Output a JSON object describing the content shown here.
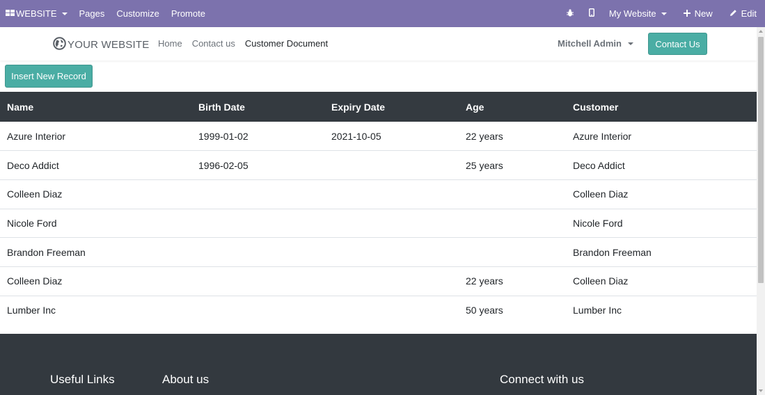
{
  "edit_bar": {
    "app_label": "WEBSITE",
    "pages": "Pages",
    "customize": "Customize",
    "promote": "Promote",
    "website_selector": "My Website",
    "new": "New",
    "edit": "Edit",
    "icons": [
      "apps-grid-icon",
      "bug-icon",
      "mobile-icon",
      "plus-icon",
      "pencil-icon"
    ]
  },
  "header": {
    "logo_text": "YOUR WEBSITE",
    "nav": [
      "Home",
      "Contact us",
      "Customer Document"
    ],
    "active_nav": "Customer Document",
    "user": "Mitchell Admin",
    "contact_button": "Contact Us"
  },
  "main": {
    "insert_button": "Insert New Record",
    "table": {
      "columns": [
        "Name",
        "Birth Date",
        "Expiry Date",
        "Age",
        "Customer"
      ],
      "rows": [
        [
          "Azure Interior",
          "1999-01-02",
          "2021-10-05",
          "22 years",
          "Azure Interior"
        ],
        [
          "Deco Addict",
          "1996-02-05",
          "",
          "25 years",
          "Deco Addict"
        ],
        [
          "Colleen Diaz",
          "",
          "",
          "",
          "Colleen Diaz"
        ],
        [
          "Nicole Ford",
          "",
          "",
          "",
          "Nicole Ford"
        ],
        [
          "Brandon Freeman",
          "",
          "",
          "",
          "Brandon Freeman"
        ],
        [
          "Colleen Diaz",
          "",
          "",
          "22 years",
          "Colleen Diaz"
        ],
        [
          "Lumber Inc",
          "",
          "",
          "50 years",
          "Lumber Inc"
        ]
      ]
    }
  },
  "footer": {
    "useful_links": "Useful Links",
    "about_us": "About us",
    "connect": "Connect with us"
  },
  "colors": {
    "edit_bar": "#7c72ad",
    "accent": "#4aada4",
    "table_header": "#343a40",
    "footer": "#33393f"
  }
}
